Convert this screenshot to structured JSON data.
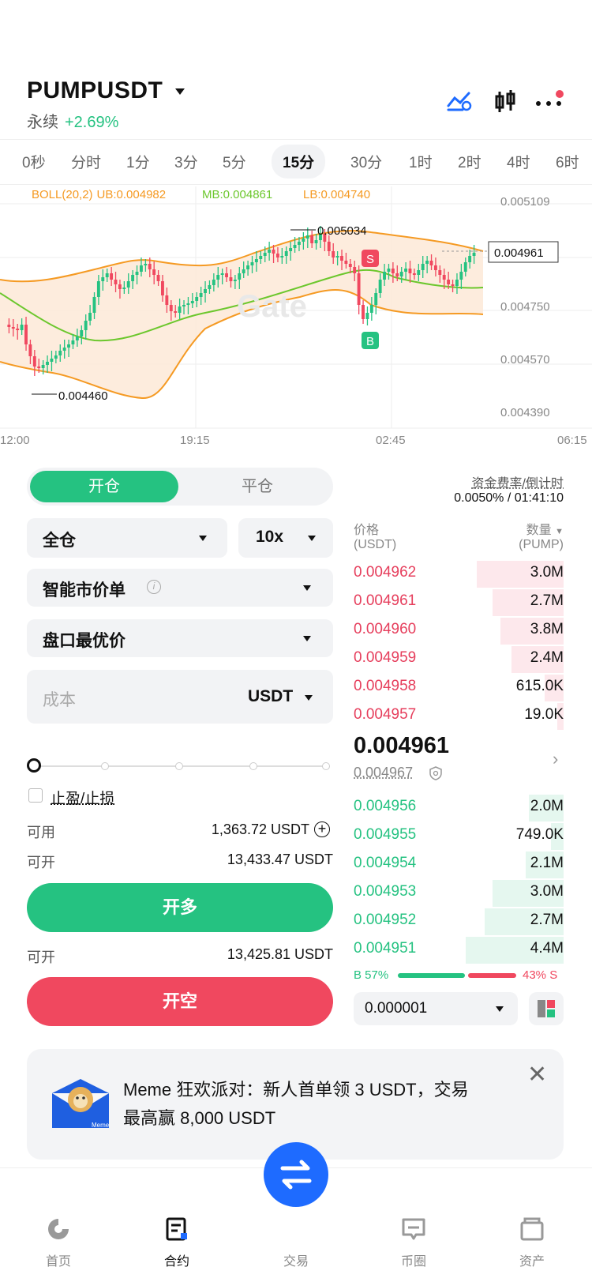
{
  "header": {
    "pair": "PUMPUSDT",
    "market_type": "永续",
    "change": "+2.69%"
  },
  "timeframes": [
    "0秒",
    "分时",
    "1分",
    "3分",
    "5分",
    "15分",
    "30分",
    "1时",
    "2时",
    "4时",
    "6时"
  ],
  "selected_timeframe": "15分",
  "chart": {
    "indicator": "BOLL(20,2)",
    "ub": "UB:0.004982",
    "mb": "MB:0.004861",
    "lb": "LB:0.004740",
    "price_ticks": [
      "0.005109",
      "0.004961",
      "0.004750",
      "0.004570",
      "0.004390"
    ],
    "time_ticks": [
      "12:00",
      "19:15",
      "02:45",
      "06:15"
    ],
    "high_label": "0.005034",
    "low_label": "0.004460",
    "current_price_tag": "0.004961",
    "sell_marker": "S",
    "buy_marker": "B",
    "watermark": "Gate"
  },
  "form": {
    "open_tab": "开仓",
    "close_tab": "平仓",
    "margin_mode": "全仓",
    "leverage": "10x",
    "order_type": "智能市价单",
    "price_type": "盘口最优价",
    "cost_placeholder": "成本",
    "cost_unit": "USDT",
    "tpsl_label": "止盈/止损",
    "available_label": "可用",
    "available_value": "1,363.72 USDT",
    "openable_label": "可开",
    "openable_long": "13,433.47 USDT",
    "long_button": "开多",
    "openable_short": "13,425.81 USDT",
    "short_button": "开空",
    "slider_fraction": 0
  },
  "orderbook": {
    "funding_label": "资金费率/倒计时",
    "funding_value": "0.0050% / 01:41:10",
    "price_header": "价格",
    "price_unit": "(USDT)",
    "qty_header": "数量",
    "qty_unit": "(PUMP)",
    "asks": [
      {
        "price": "0.004962",
        "qty": "3.0M",
        "depth": 0.55
      },
      {
        "price": "0.004961",
        "qty": "2.7M",
        "depth": 0.45
      },
      {
        "price": "0.004960",
        "qty": "3.8M",
        "depth": 0.4
      },
      {
        "price": "0.004959",
        "qty": "2.4M",
        "depth": 0.33
      },
      {
        "price": "0.004958",
        "qty": "615.0K",
        "depth": 0.12
      },
      {
        "price": "0.004957",
        "qty": "19.0K",
        "depth": 0.04
      }
    ],
    "last_price": "0.004961",
    "mark_price": "0.004967",
    "bids": [
      {
        "price": "0.004956",
        "qty": "2.0M",
        "depth": 0.22
      },
      {
        "price": "0.004955",
        "qty": "749.0K",
        "depth": 0.08
      },
      {
        "price": "0.004954",
        "qty": "2.1M",
        "depth": 0.24
      },
      {
        "price": "0.004953",
        "qty": "3.0M",
        "depth": 0.45
      },
      {
        "price": "0.004952",
        "qty": "2.7M",
        "depth": 0.5
      },
      {
        "price": "0.004951",
        "qty": "4.4M",
        "depth": 0.62
      }
    ],
    "buy_ratio": "B 57%",
    "sell_ratio": "43% S",
    "buy_fraction": 0.57,
    "precision": "0.000001"
  },
  "banner": {
    "text_line1": "Meme 狂欢派对：新人首单领 3 USDT，交易",
    "text_line2": "最高赢 8,000 USDT",
    "logo_text": "Meme"
  },
  "nav": {
    "home": "首页",
    "futures": "合约",
    "trade": "交易",
    "square": "币圈",
    "assets": "资产"
  },
  "colors": {
    "green": "#25c281",
    "red": "#f0485f",
    "blue": "#1e6bff",
    "boll_ub": "#f59a23",
    "boll_mb": "#6cc72d"
  }
}
